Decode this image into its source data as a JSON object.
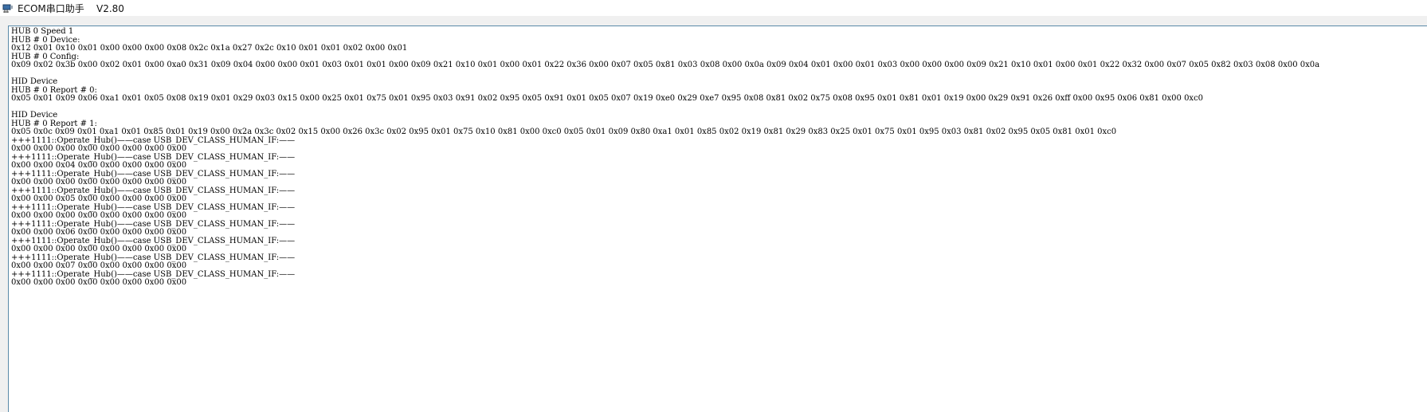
{
  "window": {
    "title": "ECOM串口助手    V2.80",
    "icon": "serial-port-icon"
  },
  "log": {
    "lines": [
      "HUB 0 Speed 1",
      "HUB # 0 Device:",
      "0x12 0x01 0x10 0x01 0x00 0x00 0x00 0x08 0x2c 0x1a 0x27 0x2c 0x10 0x01 0x01 0x02 0x00 0x01",
      "HUB # 0 Config:",
      "0x09 0x02 0x3b 0x00 0x02 0x01 0x00 0xa0 0x31 0x09 0x04 0x00 0x00 0x01 0x03 0x01 0x01 0x00 0x09 0x21 0x10 0x01 0x00 0x01 0x22 0x36 0x00 0x07 0x05 0x81 0x03 0x08 0x00 0x0a 0x09 0x04 0x01 0x00 0x01 0x03 0x00 0x00 0x00 0x09 0x21 0x10 0x01 0x00 0x01 0x22 0x32 0x00 0x07 0x05 0x82 0x03 0x08 0x00 0x0a",
      "",
      "HID Device",
      "HUB # 0 Report # 0:",
      "0x05 0x01 0x09 0x06 0xa1 0x01 0x05 0x08 0x19 0x01 0x29 0x03 0x15 0x00 0x25 0x01 0x75 0x01 0x95 0x03 0x91 0x02 0x95 0x05 0x91 0x01 0x05 0x07 0x19 0xe0 0x29 0xe7 0x95 0x08 0x81 0x02 0x75 0x08 0x95 0x01 0x81 0x01 0x19 0x00 0x29 0x91 0x26 0xff 0x00 0x95 0x06 0x81 0x00 0xc0",
      "",
      "HID Device",
      "HUB # 0 Report # 1:",
      "0x05 0x0c 0x09 0x01 0xa1 0x01 0x85 0x01 0x19 0x00 0x2a 0x3c 0x02 0x15 0x00 0x26 0x3c 0x02 0x95 0x01 0x75 0x10 0x81 0x00 0xc0 0x05 0x01 0x09 0x80 0xa1 0x01 0x85 0x02 0x19 0x81 0x29 0x83 0x25 0x01 0x75 0x01 0x95 0x03 0x81 0x02 0x95 0x05 0x81 0x01 0xc0",
      "+++1111::Operate_Hub()——case USB_DEV_CLASS_HUMAN_IF:——",
      "0x00 0x00 0x00 0x00 0x00 0x00 0x00 0x00",
      "+++1111::Operate_Hub()——case USB_DEV_CLASS_HUMAN_IF:——",
      "0x00 0x00 0x04 0x00 0x00 0x00 0x00 0x00",
      "+++1111::Operate_Hub()——case USB_DEV_CLASS_HUMAN_IF:——",
      "0x00 0x00 0x00 0x00 0x00 0x00 0x00 0x00",
      "+++1111::Operate_Hub()——case USB_DEV_CLASS_HUMAN_IF:——",
      "0x00 0x00 0x05 0x00 0x00 0x00 0x00 0x00",
      "+++1111::Operate_Hub()——case USB_DEV_CLASS_HUMAN_IF:——",
      "0x00 0x00 0x00 0x00 0x00 0x00 0x00 0x00",
      "+++1111::Operate_Hub()——case USB_DEV_CLASS_HUMAN_IF:——",
      "0x00 0x00 0x06 0x00 0x00 0x00 0x00 0x00",
      "+++1111::Operate_Hub()——case USB_DEV_CLASS_HUMAN_IF:——",
      "0x00 0x00 0x00 0x00 0x00 0x00 0x00 0x00",
      "+++1111::Operate_Hub()——case USB_DEV_CLASS_HUMAN_IF:——",
      "0x00 0x00 0x07 0x00 0x00 0x00 0x00 0x00",
      "+++1111::Operate_Hub()——case USB_DEV_CLASS_HUMAN_IF:——",
      "0x00 0x00 0x00 0x00 0x00 0x00 0x00 0x00"
    ]
  },
  "colors": {
    "frame_border": "#5a8aa8",
    "background": "#ffffff",
    "chrome": "#f0f0f0"
  }
}
